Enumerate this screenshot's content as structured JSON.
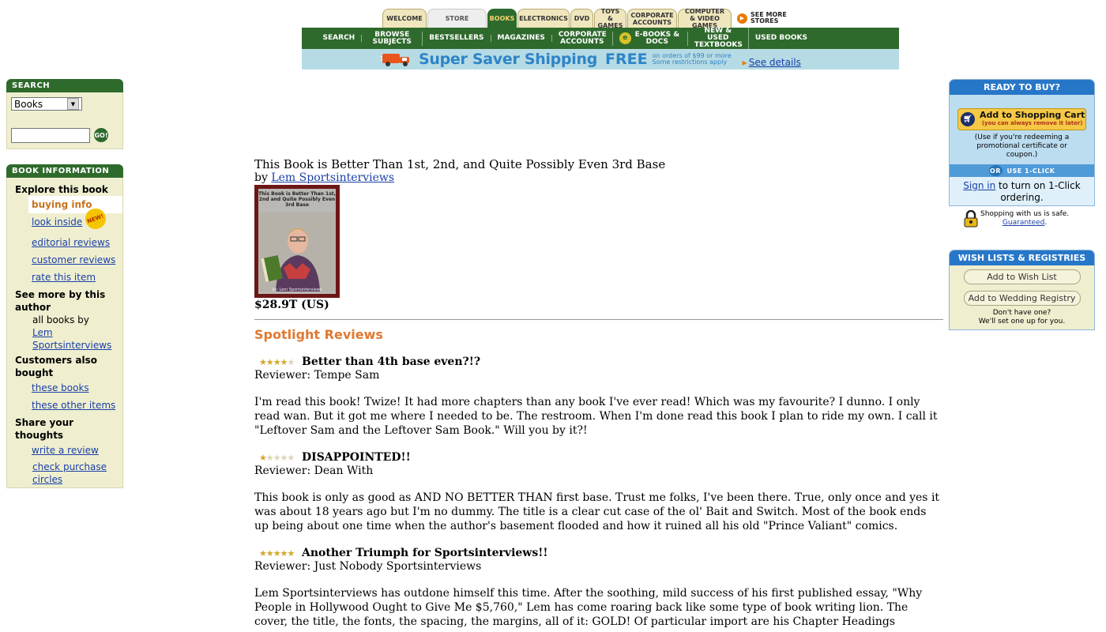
{
  "header": {
    "tabs": [
      {
        "label": "WELCOME",
        "w": 56
      },
      {
        "label": "STORE",
        "w": 75
      },
      {
        "label": "BOOKS",
        "w": 37
      },
      {
        "label": "ELECTRONICS",
        "w": 66
      },
      {
        "label": "DVD",
        "w": 29
      },
      {
        "label": "TOYS & GAMES",
        "w": 41
      },
      {
        "label": "CORPORATE ACCOUNTS",
        "w": 63
      },
      {
        "label": "COMPUTER & VIDEO GAMES",
        "w": 68
      }
    ],
    "see_more": "SEE MORE STORES",
    "subnav": [
      "SEARCH",
      "BROWSE SUBJECTS",
      "BESTSELLERS",
      "MAGAZINES",
      "CORPORATE ACCOUNTS",
      "E-BOOKS & DOCS",
      "NEW & USED TEXTBOOKS",
      "USED BOOKS"
    ],
    "banner_title": "Super Saver Shipping",
    "banner_free": "FREE",
    "banner_small_1": "on orders of $99 or more",
    "banner_small_2": "Some restrictions apply",
    "banner_link": "See details"
  },
  "search": {
    "heading": "SEARCH",
    "category": "Books",
    "query": "",
    "go_label": "GO!"
  },
  "book_info": {
    "heading": "BOOK INFORMATION",
    "explore": "Explore this book",
    "buying_info": "buying info",
    "look_inside": "look inside",
    "new_badge": "NEW!",
    "editorial_reviews": "editorial reviews",
    "customer_reviews": "customer reviews",
    "rate_item": "rate this item",
    "see_more_author": "See more by this author",
    "all_books_by": "all books by",
    "author_link": "Lem Sportsinterviews",
    "customers_bought": "Customers also bought",
    "these_books": "these books",
    "these_other_items": "these other items",
    "share_thoughts": "Share your thoughts",
    "write_review": "write a review",
    "check_circles": "check purchase circles"
  },
  "product": {
    "title": "This Book is Better Than 1st, 2nd, and Quite Possibly Even 3rd Base",
    "by": "by",
    "author": "Lem Sportsinterviews",
    "cover_title": "This Book is Better Than 1st, 2nd and Quite Possibly Even 3rd Base",
    "cover_author": "by: Lem Sportsinterviews",
    "price": "$28.9T (US)"
  },
  "reviews": {
    "heading": "Spotlight Reviews",
    "items": [
      {
        "rating": 4,
        "title": "Better than 4th base even?!?",
        "reviewer": "Reviewer: Tempe Sam",
        "body": "I'm read this book! Twize! It had more chapters than any book I've ever read! Which was my favourite? I dunno. I only read wan. But it got me where I needed to be. The restroom. When I'm done read this book I plan to ride my own. I call it \"Leftover Sam and the Leftover Sam Book.\" Will you by it?!"
      },
      {
        "rating": 1,
        "title": "DISAPPOINTED!!",
        "reviewer": "Reviewer: Dean With",
        "body": "This book is only as good as AND NO BETTER THAN first base. Trust me folks, I've been there. True, only once and yes it was about 18 years ago but I'm no dummy. The title is a clear cut case of the ol' Bait and Switch. Most of the book ends up being about one time when the author's basement flooded and how it ruined all his old \"Prince Valiant\" comics."
      },
      {
        "rating": 5,
        "title": "Another Triumph for Sportsinterviews!!",
        "reviewer": "Reviewer: Just Nobody Sportsinterviews",
        "body": "Lem Sportsinterviews has outdone himself this time. After the soothing, mild success of his first published essay, \"Why People in Hollywood Ought to Give Me $5,760,\" Lem has come roaring back like some type of book writing lion. The cover, the title, the fonts, the spacing, the margins, all of it: GOLD! Of particular import are his Chapter Headings including such tear jerkers as: 'My favorite pen quit working just"
      }
    ]
  },
  "ready": {
    "heading": "READY TO BUY?",
    "cart_label": "Add to Shopping Cart",
    "cart_sub": "(you can always remove it later)",
    "redeem_note": "(Use if you're redeeming a promotional certificate or coupon.)",
    "or_label": "OR",
    "one_click": "USE 1-CLICK",
    "sign_in": "Sign in",
    "sign_in_rest": " to turn on 1-Click ordering.",
    "safe_text": "Shopping with us is safe.",
    "guaranteed": "Guaranteed"
  },
  "wish": {
    "heading": "WISH LISTS & REGISTRIES",
    "add_wish": "Add to Wish List",
    "add_wedding": "Add to Wedding Registry",
    "dont_have_1": "Don't have one?",
    "dont_have_2": "We'll set one up for you."
  }
}
